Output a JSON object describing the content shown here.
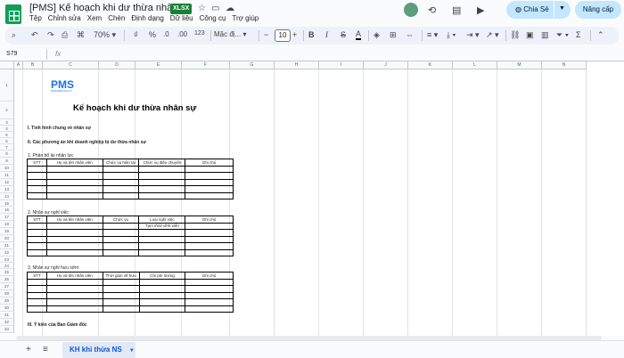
{
  "app": {
    "doc_title": "[PMS] Kế hoạch khi dư thừa nhân sự",
    "file_badge": "XLSX",
    "menu": [
      "Tệp",
      "Chỉnh sửa",
      "Xem",
      "Chèn",
      "Định dạng",
      "Dữ liệu",
      "Công cụ",
      "Trợ giúp"
    ],
    "share_label": "Chia Sẻ",
    "upgrade_label": "Nâng cấp"
  },
  "toolbar": {
    "zoom": "70%",
    "currency": "₫",
    "percent": "%",
    "dec_decrease": ".0",
    "dec_increase": ".00",
    "number_format": "123",
    "font_name": "Mặc đị...",
    "font_size": "10",
    "minus": "−",
    "plus": "+",
    "bold": "B",
    "italic": "I",
    "strike": "S",
    "text_color": "A",
    "sigma": "Σ"
  },
  "formula_bar": {
    "cell_ref": "S79",
    "fx": "fx"
  },
  "columns": [
    "A",
    "B",
    "C",
    "D",
    "E",
    "F",
    "G",
    "H",
    "I",
    "J",
    "K",
    "L",
    "M",
    "N"
  ],
  "rows": [
    "1",
    "2",
    "3",
    "4",
    "5",
    "6",
    "7",
    "8",
    "9",
    "10",
    "11",
    "12",
    "13",
    "14",
    "15",
    "16",
    "17",
    "18",
    "19",
    "20",
    "21",
    "22",
    "23",
    "24",
    "25",
    "26",
    "27",
    "28",
    "29",
    "30",
    "31",
    "32",
    "33"
  ],
  "sheet": {
    "logo_text": "PMS",
    "logo_tagline": "PHẦN MỀM QUẢN LÝ",
    "title": "Kế hoạch khi dư thừa nhân sự",
    "section1": "I. Tình hình chung về nhân sự",
    "section2": "II. Các phương án khi doanh nghiệp bị dư thừa nhân sự",
    "sub1": "1. Phân bổ lại nhân lực",
    "sub2": "2. Nhân sự nghỉ việc",
    "sub3": "3. Nhân sự nghỉ hưu sớm",
    "section3": "III. Ý kiến của Ban Giám đốc",
    "table1_headers": [
      "STT",
      "Họ và tên nhân viên",
      "Chức vụ hiện tại",
      "Chức vụ điều chuyển",
      "Ghi chú"
    ],
    "table2_headers": [
      "STT",
      "Họ và tên nhân viên",
      "Chức vụ",
      "Loại nghỉ việc",
      "Ghi chú"
    ],
    "table2_note": "Tạm thời/ vĩnh viễn",
    "table3_headers": [
      "STT",
      "Họ và tên nhân viên",
      "Thời gian về hưu",
      "Chi phí lương",
      "Ghi chú"
    ]
  },
  "tabs": {
    "active": "KH khi thừa NS"
  },
  "colors": {
    "brand": "#0f9d58",
    "accent": "#c2e7ff",
    "logo_blue": "#1a73e8"
  }
}
